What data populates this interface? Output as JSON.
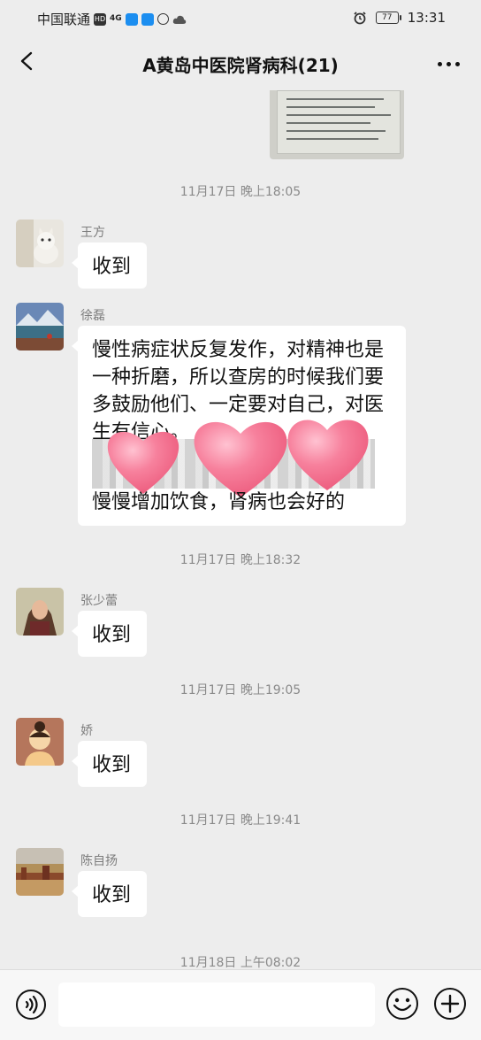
{
  "status_bar": {
    "carrier": "中国联通",
    "hd_badge": "HD",
    "network": "4G",
    "battery": "77",
    "time": "13:31"
  },
  "nav": {
    "title": "A黄岛中医院肾病科(21)"
  },
  "messages": [
    {
      "time": "11月17日 晚上18:05",
      "sender": "王方",
      "text": "收到"
    },
    {
      "sender": "徐磊",
      "lines": [
        "慢性病症状反复发作，对精神也是",
        "一种折磨，所以查房的时候我们要",
        "多鼓励他们、一定要对自己，对医",
        "生有信心。"
      ],
      "last_line": "慢慢增加饮食，肾病也会好的"
    },
    {
      "time": "11月17日 晚上18:32",
      "sender": "张少蕾",
      "text": "收到"
    },
    {
      "time": "11月17日 晚上19:05",
      "sender": "娇",
      "text": "收到"
    },
    {
      "time": "11月17日 晚上19:41",
      "sender": "陈自扬",
      "text": "收到"
    },
    {
      "time": "11月18日 上午08:02"
    }
  ],
  "colors": {
    "background": "#ededed",
    "bubble": "#ffffff",
    "heart": "#f5708f"
  },
  "icons": [
    "back-icon",
    "more-icon",
    "voice-icon",
    "emoji-icon",
    "plus-icon"
  ]
}
